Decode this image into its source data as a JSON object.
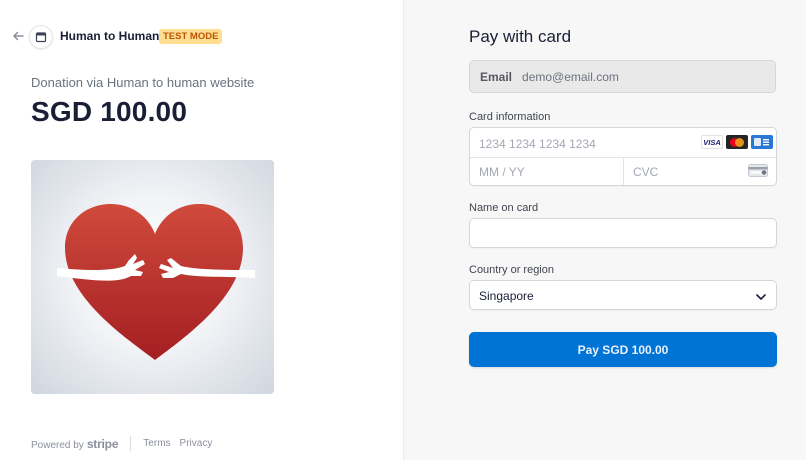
{
  "merchant": {
    "name": "Human to Human",
    "test_badge": "TEST MODE"
  },
  "product": {
    "name": "Donation via Human to human website",
    "amount": "SGD 100.00"
  },
  "footer": {
    "powered_by": "Powered by",
    "brand": "stripe",
    "terms": "Terms",
    "privacy": "Privacy"
  },
  "form": {
    "title": "Pay with card",
    "email": {
      "label": "Email",
      "value": "demo@email.com"
    },
    "card": {
      "label": "Card information",
      "number_placeholder": "1234 1234 1234 1234",
      "expiry_placeholder": "MM / YY",
      "cvc_placeholder": "CVC",
      "brands": [
        "VISA",
        "mastercard",
        "AMEX"
      ]
    },
    "name_on_card": {
      "label": "Name on card",
      "value": ""
    },
    "country": {
      "label": "Country or region",
      "value": "Singapore"
    },
    "pay_button": "Pay SGD 100.00"
  },
  "colors": {
    "accent": "#0074d4",
    "badge_bg": "#ffde92",
    "badge_text": "#bb5504",
    "heart": "#c0392b"
  },
  "icons": {
    "back": "arrow-left-icon",
    "merchant": "store-icon",
    "chevron": "chevron-down-icon",
    "cvc": "card-back-icon"
  }
}
